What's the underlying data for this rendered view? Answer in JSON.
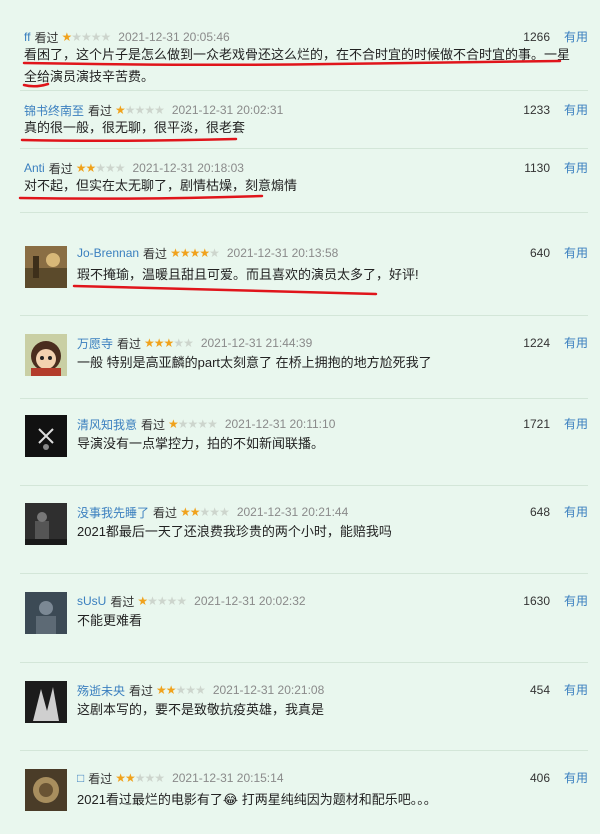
{
  "comments": [
    {
      "user": "ff",
      "status": "看过",
      "rating": 1,
      "time": "2021-12-31 20:05:46",
      "votes": "1266",
      "useful": "有用",
      "text": "看困了，这个片子是怎么做到一众老戏骨还这么烂的，在不合时宜的时候做不合时宜的事。一星全给演员演技辛苦费。"
    },
    {
      "user": "锦书终南至",
      "status": "看过",
      "rating": 1,
      "time": "2021-12-31 20:02:31",
      "votes": "1233",
      "useful": "有用",
      "text": "真的很一般，很无聊，很平淡，很老套"
    },
    {
      "user": "Anti",
      "status": "看过",
      "rating": 2,
      "time": "2021-12-31 20:18:03",
      "votes": "1130",
      "useful": "有用",
      "text": "对不起，但实在太无聊了，剧情枯燥，刻意煽情"
    },
    {
      "user": "Jo-Brennan",
      "status": "看过",
      "rating": 4,
      "time": "2021-12-31 20:13:58",
      "votes": "640",
      "useful": "有用",
      "text": "瑕不掩瑜，温暖且甜且可爱。而且喜欢的演员太多了，好评!"
    },
    {
      "user": "万愿寺",
      "status": "看过",
      "rating": 3,
      "time": "2021-12-31 21:44:39",
      "votes": "1224",
      "useful": "有用",
      "text": "一般 特别是高亚麟的part太刻意了 在桥上拥抱的地方尬死我了"
    },
    {
      "user": "清风知我意",
      "status": "看过",
      "rating": 1,
      "time": "2021-12-31 20:11:10",
      "votes": "1721",
      "useful": "有用",
      "text": "导演没有一点掌控力，拍的不如新闻联播。"
    },
    {
      "user": "没事我先睡了",
      "status": "看过",
      "rating": 2,
      "time": "2021-12-31 20:21:44",
      "votes": "648",
      "useful": "有用",
      "text": "2021都最后一天了还浪费我珍贵的两个小时，能赔我吗"
    },
    {
      "user": "sUsU",
      "status": "看过",
      "rating": 1,
      "time": "2021-12-31 20:02:32",
      "votes": "1630",
      "useful": "有用",
      "text": "不能更难看"
    },
    {
      "user": "殇逝未央",
      "status": "看过",
      "rating": 2,
      "time": "2021-12-31 20:21:08",
      "votes": "454",
      "useful": "有用",
      "text": "这剧本写的，要不是致敬抗疫英雄，我真是"
    },
    {
      "user": "□",
      "status": "看过",
      "rating": 2,
      "time": "2021-12-31 20:15:14",
      "votes": "406",
      "useful": "有用",
      "text": "2021看过最烂的电影有了😂 打两星纯纯因为题材和配乐吧。。。"
    }
  ],
  "colors": {
    "background": "#e9f7ee",
    "username": "#3a7fbf",
    "star": "#f0a21c",
    "underline": "#e0151b"
  }
}
